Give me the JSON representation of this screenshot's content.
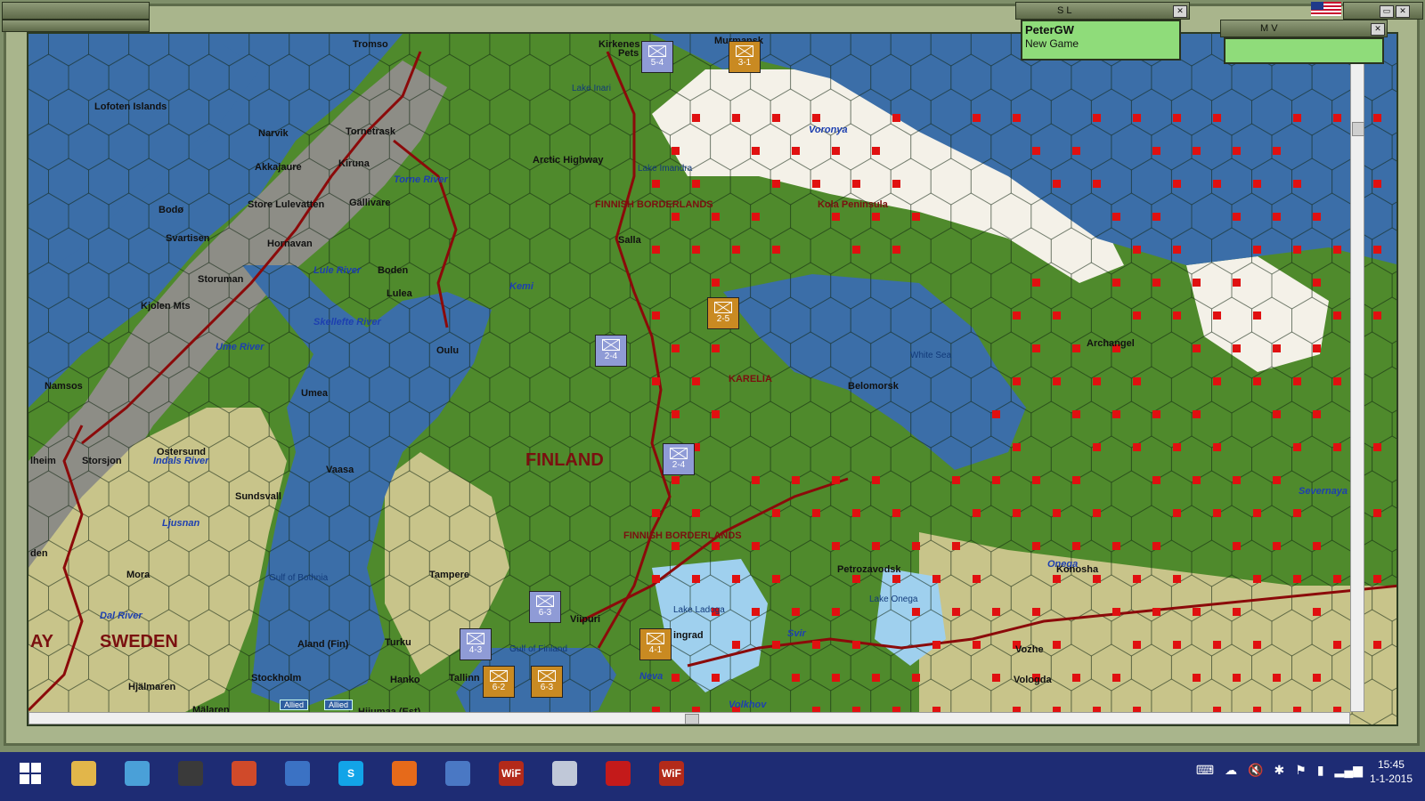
{
  "panels": {
    "sl": {
      "title": "S L",
      "player": "PeterGW",
      "game": "New Game"
    },
    "mv": {
      "title": "M V"
    }
  },
  "colors": {
    "sea": "#3b6ea8",
    "coast": "#9fd0ee",
    "forest": "#4f8a2c",
    "grass": "#c8c48a",
    "tundra": "#f4f1e8",
    "mountain": "#8d8d86",
    "border": "#8b0a0a",
    "control_marker": "#e01010"
  },
  "map": {
    "countries": [
      {
        "name": "FINLAND"
      },
      {
        "name": "SWEDEN"
      },
      {
        "name": "AY"
      }
    ],
    "regions": [
      {
        "name": "FINNISH BORDERLANDS"
      },
      {
        "name": "FINNISH BORDERLANDS"
      },
      {
        "name": "KARELIA"
      },
      {
        "name": "Kola Peninsula"
      }
    ],
    "rivers": [
      "Torne River",
      "Lule River",
      "Skellefte River",
      "Ume River",
      "Indals River",
      "Ljusnan",
      "Dal River",
      "Kemi",
      "Voronya",
      "Onega",
      "Svir",
      "Neva",
      "Volkhov",
      "Severnaya"
    ],
    "water": [
      "White Sea",
      "Gulf of Bothnia",
      "Gulf of Finland",
      "Lake Ladoga",
      "Lake Onega",
      "Lake Inari",
      "Lake Imandra"
    ],
    "cities": [
      "Tromso",
      "Narvik",
      "Kirkenes",
      "Pets",
      "Murmansk",
      "Kiruna",
      "Gällivare",
      "Boden",
      "Lulea",
      "Oulu",
      "Umea",
      "Vaasa",
      "Sundsvall",
      "Tampere",
      "Turku",
      "Hanko",
      "Tallinn",
      "Viipuri",
      "ingrad",
      "Stockholm",
      "Archangel",
      "Belomorsk",
      "Petrozavodsk",
      "Vologda",
      "Konosha",
      "Vozhe",
      "Salla",
      "Namsos",
      "Ostersund",
      "Mora",
      "lheim",
      "Aland (Fin)",
      "Lofoten Islands",
      "Bodø",
      "Svartisen",
      "Storuman",
      "Hornavan",
      "Store Lulevatten",
      "Akkajaure",
      "Tornetrask",
      "Kjolen Mts",
      "Storsjon",
      "Hjälmaren",
      "Mälaren",
      "Arctic Highway",
      "Hiiumaa (Est)",
      "den"
    ],
    "units": [
      {
        "side": "fin",
        "strength": "5-4"
      },
      {
        "side": "sov",
        "strength": "3-1"
      },
      {
        "side": "sov",
        "strength": "2-5"
      },
      {
        "side": "fin",
        "strength": "2-4"
      },
      {
        "side": "fin",
        "strength": "2-4"
      },
      {
        "side": "fin",
        "strength": "6-3"
      },
      {
        "side": "fin",
        "strength": "4-3"
      },
      {
        "side": "sov",
        "strength": "4-1"
      },
      {
        "side": "sov",
        "strength": "6-2"
      },
      {
        "side": "sov",
        "strength": "6-3"
      }
    ],
    "tags": [
      "Allied",
      "Allied"
    ]
  },
  "taskbar": {
    "apps": [
      {
        "name": "windows-start",
        "label": ""
      },
      {
        "name": "file-explorer",
        "label": ""
      },
      {
        "name": "media-player",
        "label": ""
      },
      {
        "name": "paint",
        "label": ""
      },
      {
        "name": "chrome",
        "label": ""
      },
      {
        "name": "thunderbird",
        "label": ""
      },
      {
        "name": "skype",
        "label": "S"
      },
      {
        "name": "firefox",
        "label": ""
      },
      {
        "name": "ballot",
        "label": ""
      },
      {
        "name": "wif-1",
        "label": "WiF"
      },
      {
        "name": "notepad",
        "label": ""
      },
      {
        "name": "acrobat",
        "label": ""
      },
      {
        "name": "wif-2",
        "label": "WiF"
      }
    ],
    "time": "15:45",
    "date": "1-1-2015"
  }
}
